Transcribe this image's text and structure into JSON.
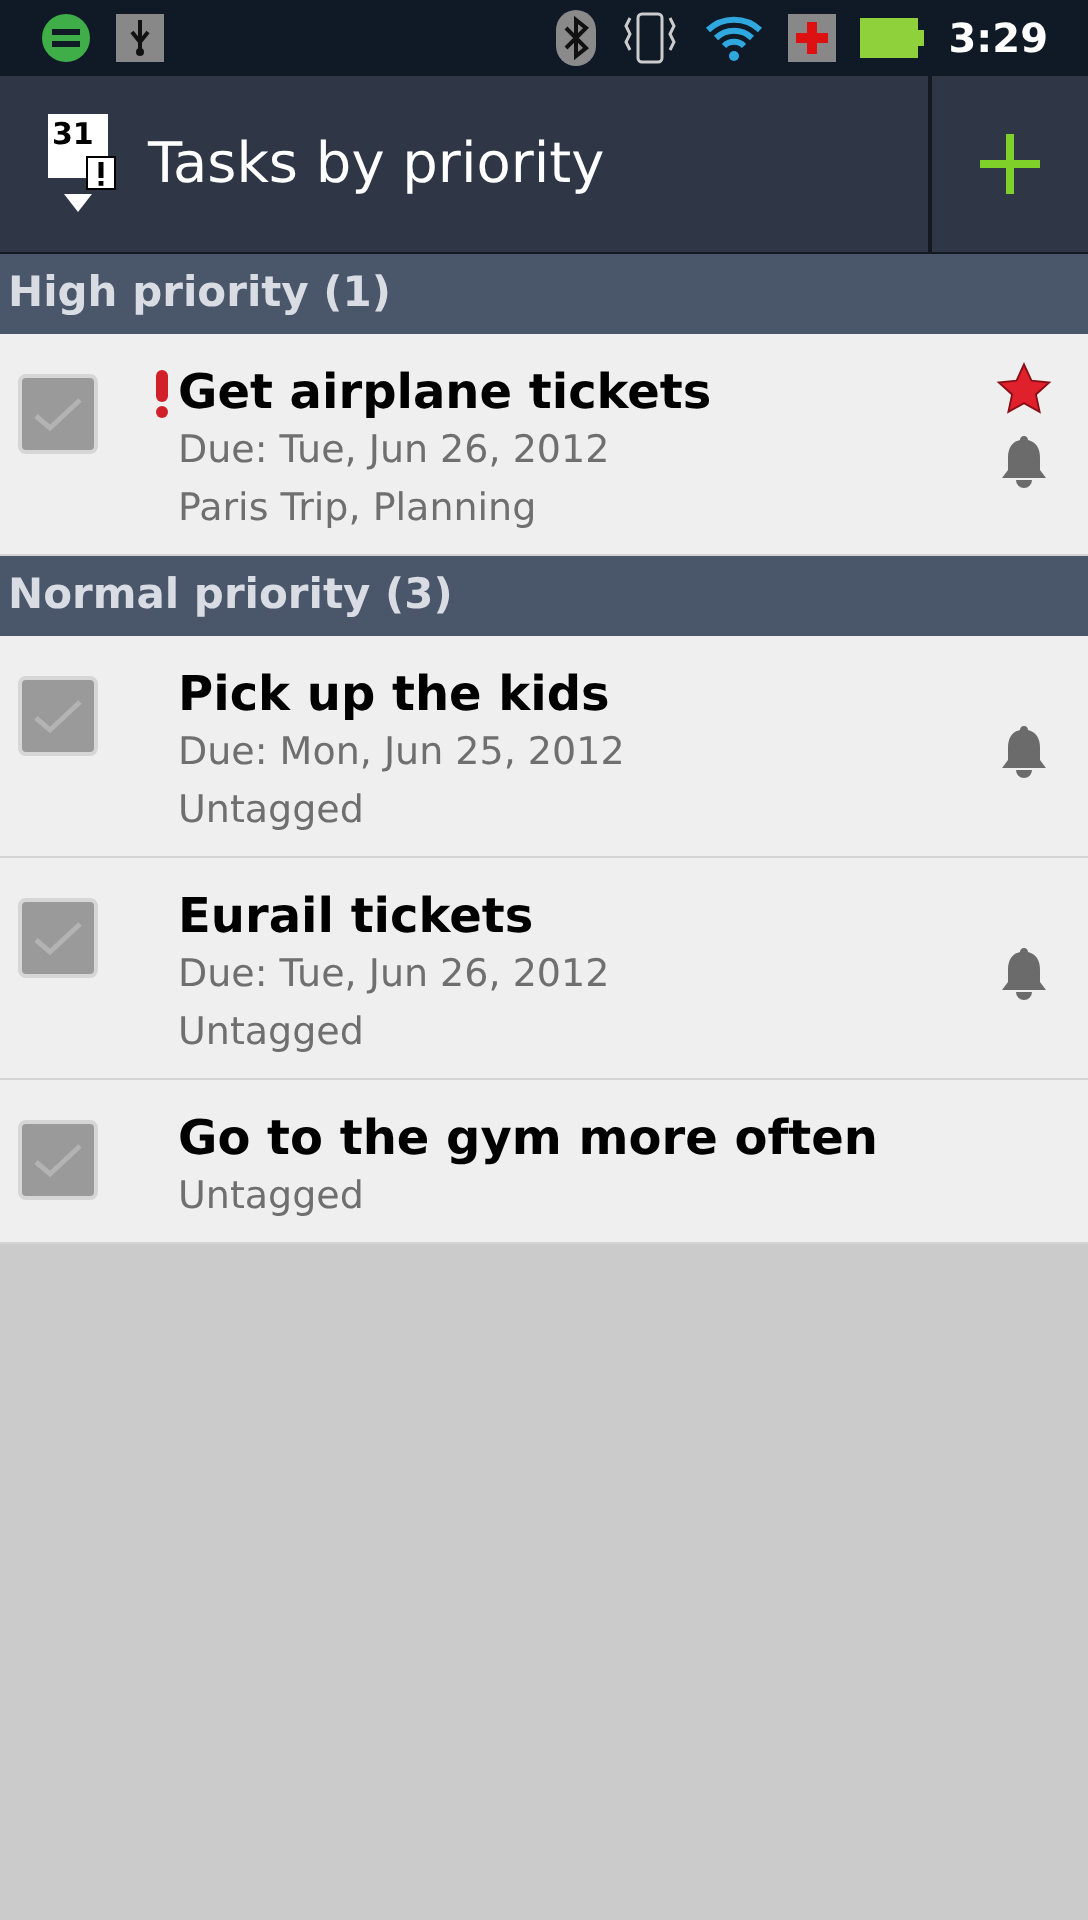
{
  "status_bar": {
    "time": "3:29"
  },
  "header": {
    "app_icon_day": "31",
    "title": "Tasks by priority"
  },
  "sections": [
    {
      "title": "High priority (1)",
      "tasks": [
        {
          "title": "Get airplane tickets",
          "important": true,
          "starred": true,
          "reminder": true,
          "checked": false,
          "lines": [
            "Due: Tue, Jun 26, 2012",
            "Paris Trip, Planning"
          ]
        }
      ]
    },
    {
      "title": "Normal priority (3)",
      "tasks": [
        {
          "title": "Pick up the kids",
          "important": false,
          "starred": false,
          "reminder": true,
          "checked": false,
          "lines": [
            "Due: Mon, Jun 25, 2012",
            "Untagged"
          ]
        },
        {
          "title": "Eurail tickets",
          "important": false,
          "starred": false,
          "reminder": true,
          "checked": false,
          "lines": [
            "Due: Tue, Jun 26, 2012",
            "Untagged"
          ]
        },
        {
          "title": "Go to the gym more often",
          "important": false,
          "starred": false,
          "reminder": false,
          "checked": false,
          "lines": [
            "Untagged"
          ]
        }
      ]
    }
  ]
}
